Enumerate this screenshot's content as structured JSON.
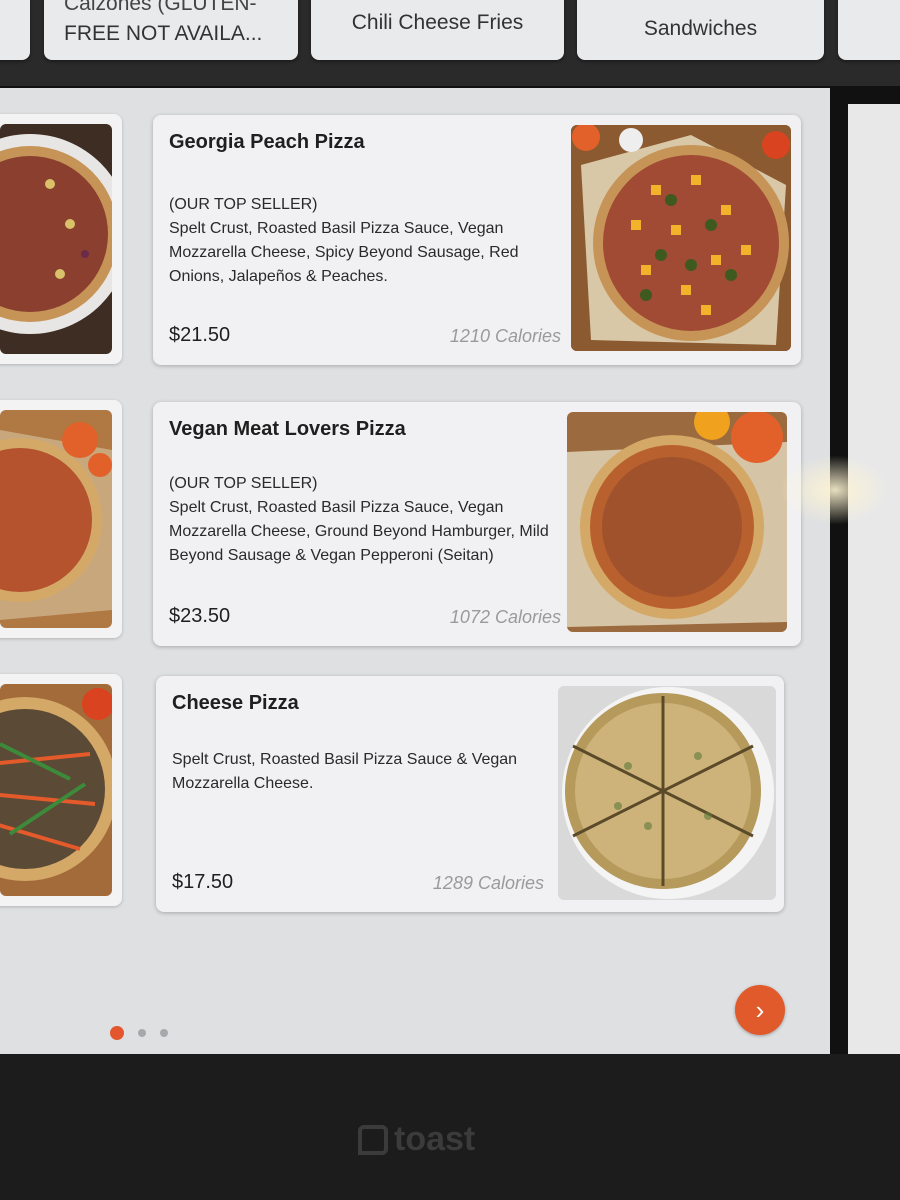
{
  "categories": [
    {
      "label": "Calzones (GLUTEN-",
      "label2": "FREE NOT AVAILA..."
    },
    {
      "label": "Chili Cheese Fries"
    },
    {
      "label": "Sandwiches"
    }
  ],
  "items": [
    {
      "name": "Georgia Peach Pizza",
      "tag": "(OUR TOP SELLER)",
      "description": "Spelt Crust, Roasted Basil Pizza Sauce, Vegan Mozzarella Cheese, Spicy Beyond Sausage,  Red Onions, Jalapeños & Peaches.",
      "price": "$21.50",
      "calories": "1210 Calories"
    },
    {
      "name": "Vegan Meat Lovers Pizza",
      "tag": "(OUR TOP SELLER)",
      "description": "Spelt Crust, Roasted Basil Pizza Sauce, Vegan Mozzarella Cheese, Ground Beyond Hamburger, Mild Beyond Sausage & Vegan Pepperoni (Seitan)",
      "price": "$23.50",
      "calories": "1072 Calories"
    },
    {
      "name": "Cheese Pizza",
      "tag": "",
      "description": "Spelt Crust, Roasted Basil Pizza Sauce & Vegan Mozzarella Cheese.",
      "price": "$17.50",
      "calories": "1289 Calories"
    }
  ],
  "pagination": {
    "pages": 3,
    "current": 1
  },
  "next_icon": "chevron-right-icon",
  "brand": "toast",
  "colors": {
    "accent": "#e15a2c",
    "panel": "#dfe0e2",
    "card": "#f1f1f3"
  }
}
